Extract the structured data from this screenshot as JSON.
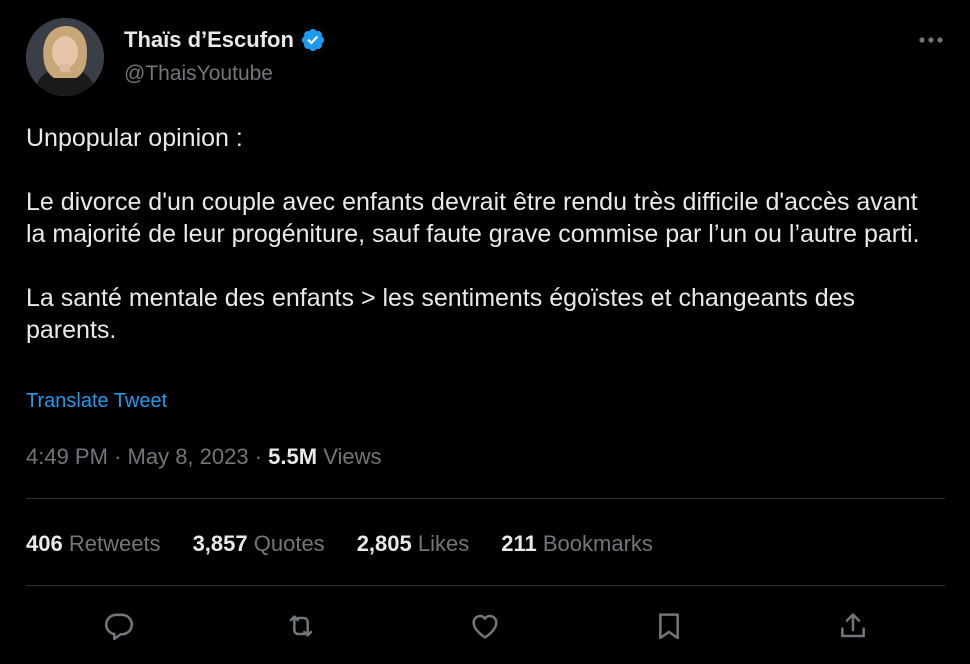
{
  "author": {
    "name": "Thaïs d’Escufon",
    "handle": "@ThaisYoutube",
    "verified": true
  },
  "icons": {
    "more": "more-icon",
    "verified": "verified-badge-icon",
    "reply": "reply-icon",
    "retweet": "retweet-icon",
    "like": "like-icon",
    "bookmark": "bookmark-icon",
    "share": "share-icon"
  },
  "tweet": {
    "paragraphs": [
      "Unpopular opinion :",
      "Le divorce d'un couple avec enfants devrait être rendu très difficile d'accès avant la majorité de leur progéniture, sauf faute grave commise par l’un ou l’autre parti.",
      "La santé mentale des enfants > les sentiments égoïstes et changeants des parents."
    ],
    "translate_label": "Translate Tweet"
  },
  "meta": {
    "time": "4:49 PM",
    "separator": "·",
    "date": "May 8, 2023",
    "views_count": "5.5M",
    "views_label": "Views"
  },
  "stats": [
    {
      "count": "406",
      "label": "Retweets"
    },
    {
      "count": "3,857",
      "label": "Quotes"
    },
    {
      "count": "2,805",
      "label": "Likes"
    },
    {
      "count": "211",
      "label": "Bookmarks"
    }
  ],
  "colors": {
    "background": "#000000",
    "text": "#e7e9ea",
    "secondary": "#71767b",
    "accent": "#1d9bf0",
    "divider": "#2f3336"
  }
}
